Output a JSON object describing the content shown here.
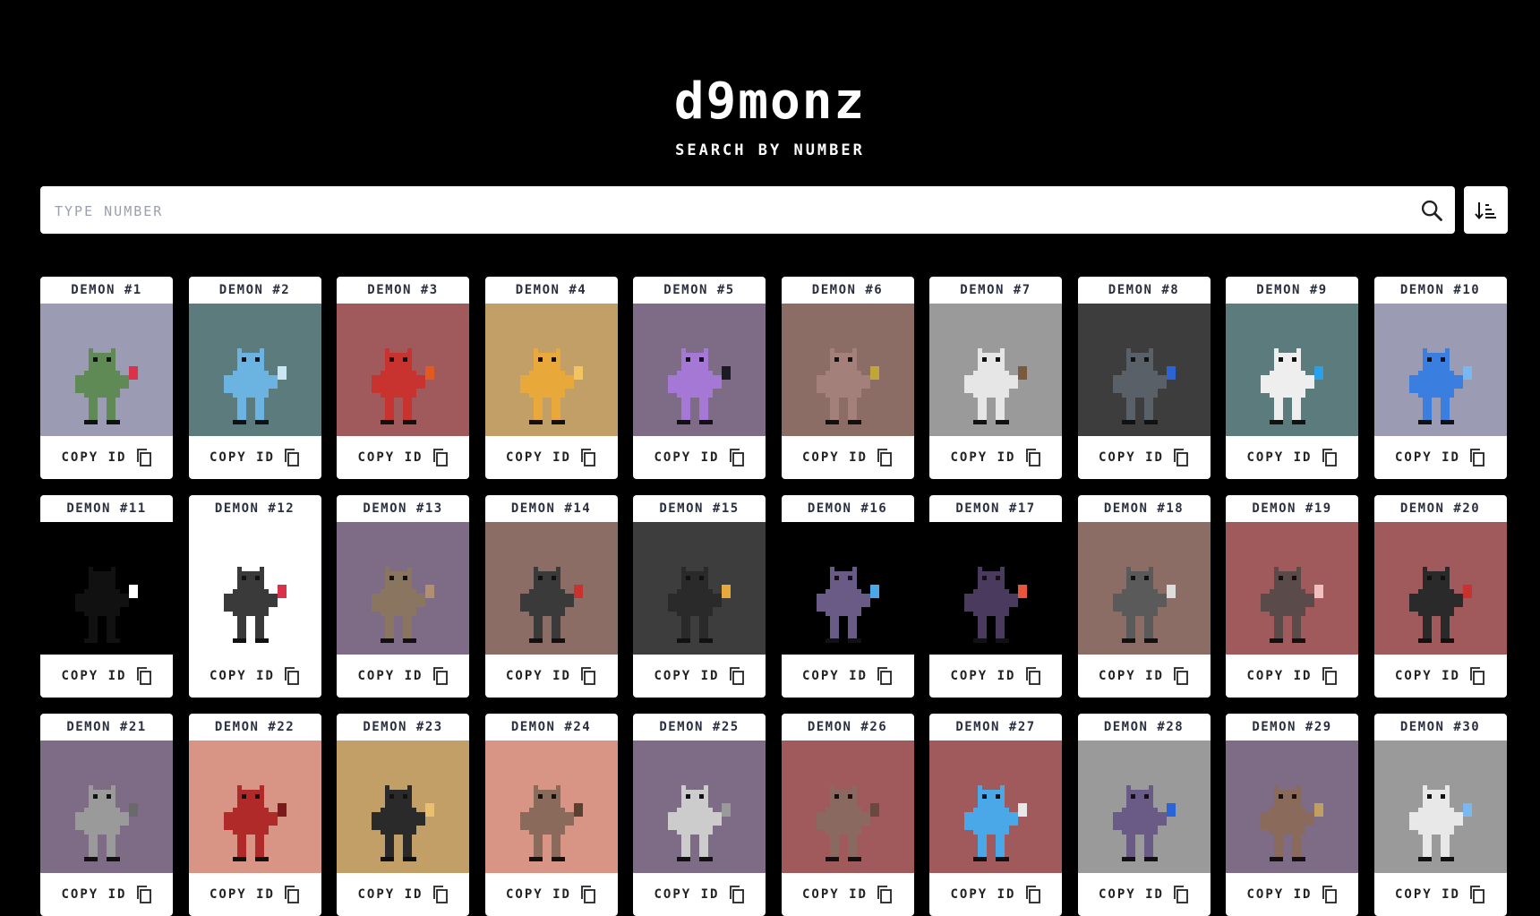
{
  "header": {
    "logo": "d9monz",
    "subtitle": "SEARCH BY NUMBER"
  },
  "search": {
    "placeholder": "TYPE NUMBER",
    "value": ""
  },
  "icons": {
    "search": "search-icon",
    "sort": "sort-ascending-icon",
    "copy": "copy-icon"
  },
  "cards": [
    {
      "title": "DEMON #1",
      "copy_label": "COPY ID",
      "bg": "#9b9bb3",
      "body": "#5f8a55",
      "accent": "#d8334a"
    },
    {
      "title": "DEMON #2",
      "copy_label": "COPY ID",
      "bg": "#5b7b7d",
      "body": "#6bb3e0",
      "accent": "#c9e6f2"
    },
    {
      "title": "DEMON #3",
      "copy_label": "COPY ID",
      "bg": "#a05a5c",
      "body": "#c9332f",
      "accent": "#e35a1e"
    },
    {
      "title": "DEMON #4",
      "copy_label": "COPY ID",
      "bg": "#c19f66",
      "body": "#e8a93a",
      "accent": "#f2c462"
    },
    {
      "title": "DEMON #5",
      "copy_label": "COPY ID",
      "bg": "#7e6c86",
      "body": "#a678d6",
      "accent": "#1b1b24"
    },
    {
      "title": "DEMON #6",
      "copy_label": "COPY ID",
      "bg": "#8c6d65",
      "body": "#a3817a",
      "accent": "#c0a53a"
    },
    {
      "title": "DEMON #7",
      "copy_label": "COPY ID",
      "bg": "#9a9a9a",
      "body": "#e6e6e6",
      "accent": "#7a5a3c"
    },
    {
      "title": "DEMON #8",
      "copy_label": "COPY ID",
      "bg": "#3d3d3d",
      "body": "#5a6068",
      "accent": "#2a64d6"
    },
    {
      "title": "DEMON #9",
      "copy_label": "COPY ID",
      "bg": "#5b7b7d",
      "body": "#eeeeee",
      "accent": "#2aa0e8"
    },
    {
      "title": "DEMON #10",
      "copy_label": "COPY ID",
      "bg": "#9b9bb3",
      "body": "#3a7fe0",
      "accent": "#7ab8f2"
    },
    {
      "title": "DEMON #11",
      "copy_label": "COPY ID",
      "bg": "#000000",
      "body": "#111111",
      "accent": "#ffffff"
    },
    {
      "title": "DEMON #12",
      "copy_label": "COPY ID",
      "bg": "#ffffff",
      "body": "#3a3a3a",
      "accent": "#d8334a"
    },
    {
      "title": "DEMON #13",
      "copy_label": "COPY ID",
      "bg": "#7e6c86",
      "body": "#8a7560",
      "accent": "#b09070"
    },
    {
      "title": "DEMON #14",
      "copy_label": "COPY ID",
      "bg": "#8c6d65",
      "body": "#3a3a3a",
      "accent": "#c9332f"
    },
    {
      "title": "DEMON #15",
      "copy_label": "COPY ID",
      "bg": "#3d3d3d",
      "body": "#2a2a2a",
      "accent": "#e8a93a"
    },
    {
      "title": "DEMON #16",
      "copy_label": "COPY ID",
      "bg": "#000000",
      "body": "#6a5a86",
      "accent": "#4aa8e8"
    },
    {
      "title": "DEMON #17",
      "copy_label": "COPY ID",
      "bg": "#000000",
      "body": "#4a3a5e",
      "accent": "#e8553a"
    },
    {
      "title": "DEMON #18",
      "copy_label": "COPY ID",
      "bg": "#8c6d65",
      "body": "#5a5a5a",
      "accent": "#dddddd"
    },
    {
      "title": "DEMON #19",
      "copy_label": "COPY ID",
      "bg": "#a05a5c",
      "body": "#5a4a4a",
      "accent": "#f0c0c0"
    },
    {
      "title": "DEMON #20",
      "copy_label": "COPY ID",
      "bg": "#a05a5c",
      "body": "#2a2a2a",
      "accent": "#c9332f"
    },
    {
      "title": "DEMON #21",
      "copy_label": "COPY ID",
      "bg": "#7e6c86",
      "body": "#9a9a9a",
      "accent": "#6a6a6a"
    },
    {
      "title": "DEMON #22",
      "copy_label": "COPY ID",
      "bg": "#d89585",
      "body": "#b02a2a",
      "accent": "#7a1a1a"
    },
    {
      "title": "DEMON #23",
      "copy_label": "COPY ID",
      "bg": "#c19f66",
      "body": "#2a2a2a",
      "accent": "#e8c070"
    },
    {
      "title": "DEMON #24",
      "copy_label": "COPY ID",
      "bg": "#d89585",
      "body": "#8a6a5a",
      "accent": "#5a4030"
    },
    {
      "title": "DEMON #25",
      "copy_label": "COPY ID",
      "bg": "#7e6c86",
      "body": "#cccccc",
      "accent": "#9a9a9a"
    },
    {
      "title": "DEMON #26",
      "copy_label": "COPY ID",
      "bg": "#a05a5c",
      "body": "#8a6a60",
      "accent": "#6a4a40"
    },
    {
      "title": "DEMON #27",
      "copy_label": "COPY ID",
      "bg": "#a05a5c",
      "body": "#4aa8e8",
      "accent": "#e8e8e8"
    },
    {
      "title": "DEMON #28",
      "copy_label": "COPY ID",
      "bg": "#9a9a9a",
      "body": "#6a5a86",
      "accent": "#2a64d6"
    },
    {
      "title": "DEMON #29",
      "copy_label": "COPY ID",
      "bg": "#7e6c86",
      "body": "#8a6a5a",
      "accent": "#c0a060"
    },
    {
      "title": "DEMON #30",
      "copy_label": "COPY ID",
      "bg": "#9a9a9a",
      "body": "#e8e8e8",
      "accent": "#7ab8f2"
    }
  ]
}
